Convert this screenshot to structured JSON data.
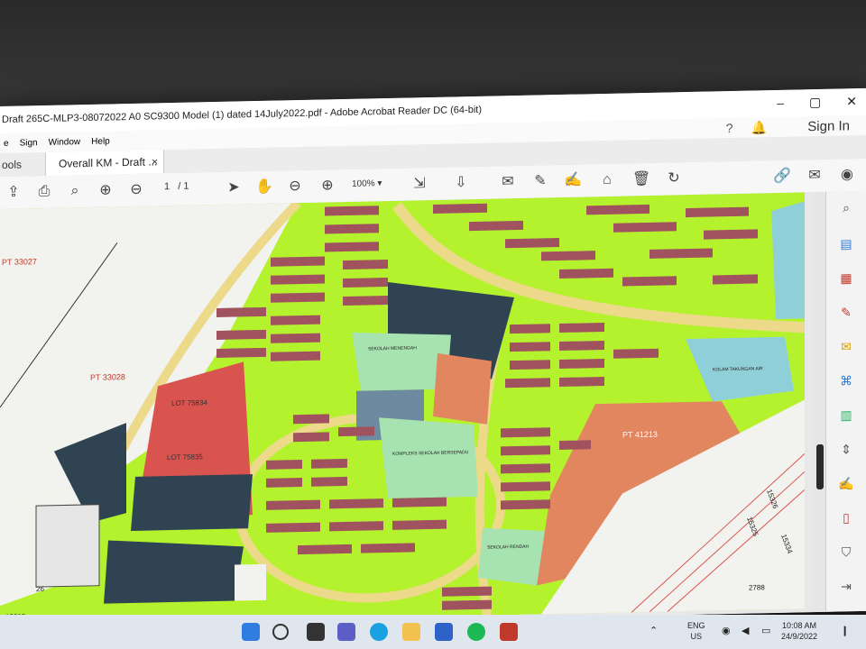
{
  "window": {
    "title": "Draft 265C-MLP3-08072022 A0 SC9300 Model (1) dated 14July2022.pdf - Adobe Acrobat Reader DC (64-bit)",
    "minimize": "–",
    "restore": "▢",
    "close": "✕"
  },
  "menu": {
    "items": [
      "e",
      "Sign",
      "Window",
      "Help"
    ],
    "sign_in": "Sign In"
  },
  "tabs": {
    "tools": "ools",
    "doc": "Overall KM - Draft ...",
    "doc_close": "×"
  },
  "toolbar": {
    "page_current": "1",
    "page_sep": "/",
    "page_total": "1",
    "zoom": "100%"
  },
  "map": {
    "labels": {
      "pt33027": "PT 33027",
      "pt33028": "PT 33028",
      "lot1": "LOT 75834",
      "lot2": "LOT 75835",
      "pt41213": "PT 41213",
      "sekolah_menengah": "SEKOLAH MENENGAH",
      "kompleks": "KOMPLEKS SEKOLAH BERSEPADU",
      "sekolah_rendah": "SEKOLAH RENDAH",
      "kolam": "KOLAM TAKUNGAN AIR",
      "n15326": "15326",
      "n15325": "15325",
      "n15334": "15334",
      "n2788": "2788",
      "n26": "26",
      "n12618": "12618"
    },
    "colors": {
      "residential": "#a0525e",
      "road": "#ecd98a",
      "green": "#b5f22e",
      "navy": "#2f4353",
      "red": "#d9534f",
      "salmon": "#e28660",
      "lightgreen": "#a7e3b0",
      "water": "#8fd0d8"
    }
  },
  "taskbar": {
    "lang_top": "ENG",
    "lang_bottom": "US",
    "time": "10:08 AM",
    "date": "24/9/2022"
  }
}
